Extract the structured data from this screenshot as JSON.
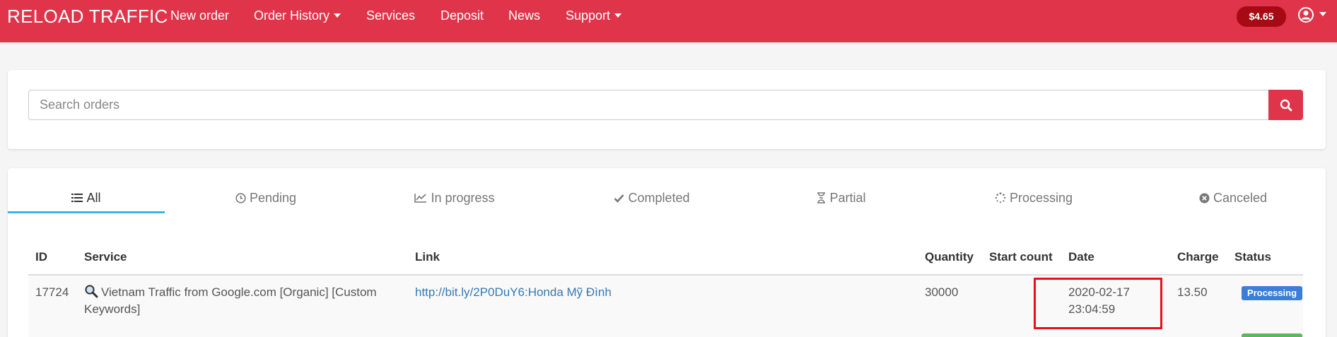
{
  "navbar": {
    "brand": "RELOAD TRAFFIC",
    "items": [
      {
        "label": "New order"
      },
      {
        "label": "Order History"
      },
      {
        "label": "Services"
      },
      {
        "label": "Deposit"
      },
      {
        "label": "News"
      },
      {
        "label": "Support"
      }
    ],
    "balance": "$4.65",
    "user_icon": "user-circle-icon"
  },
  "search": {
    "placeholder": "Search orders",
    "button_icon": "search-icon"
  },
  "tabs": [
    {
      "label": "All",
      "icon": "list-icon",
      "active": true
    },
    {
      "label": "Pending",
      "icon": "clock-icon"
    },
    {
      "label": "In progress",
      "icon": "line-chart-icon"
    },
    {
      "label": "Completed",
      "icon": "check-icon"
    },
    {
      "label": "Partial",
      "icon": "hourglass-icon"
    },
    {
      "label": "Processing",
      "icon": "spinner-icon"
    },
    {
      "label": "Canceled",
      "icon": "times-circle-icon"
    }
  ],
  "table": {
    "columns": [
      "ID",
      "Service",
      "Link",
      "Quantity",
      "Start count",
      "Date",
      "Charge",
      "Status"
    ],
    "rows": [
      {
        "id": "17724",
        "service": "Vietnam Traffic from Google.com [Organic] [Custom Keywords]",
        "service_icon": "magnifier-icon",
        "link": "http://bit.ly/2P0DuY6:Honda Mỹ Đình",
        "quantity": "30000",
        "start_count": "",
        "date": "2020-02-17",
        "time": "23:04:59",
        "charge": "13.50",
        "status": "Processing"
      }
    ]
  },
  "colors": {
    "brand": "#e0344a",
    "balance_badge": "#a60a14",
    "active_tab": "#3cb4e8",
    "link": "#337ab7",
    "status_processing": "#3c7dd9",
    "highlight": "#e8101a"
  }
}
